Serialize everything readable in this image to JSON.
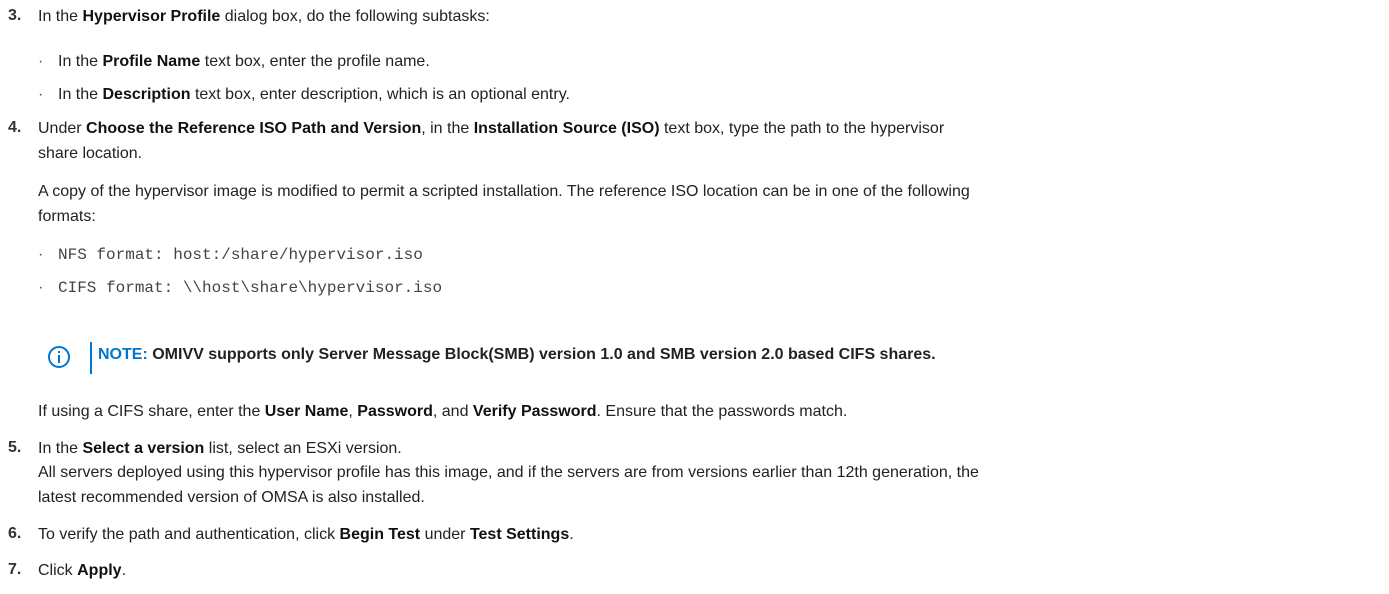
{
  "steps": [
    {
      "number": "3.",
      "intro": [
        "In the ",
        "Hypervisor Profile",
        " dialog box, do the following subtasks:"
      ],
      "bullets": [
        [
          "In the ",
          "Profile Name",
          " text box, enter the profile name."
        ],
        [
          "In the ",
          "Description",
          " text box, enter description, which is an optional entry."
        ]
      ]
    },
    {
      "number": "4.",
      "line1": [
        "Under ",
        "Choose the Reference ISO Path and Version",
        ", in the ",
        "Installation Source (ISO)",
        " text box, type the path to the hypervisor"
      ],
      "line2": "share location.",
      "para1": "A copy of the hypervisor image is modified to permit a scripted installation. The reference ISO location can be in one of the following",
      "para2": "formats:",
      "formats": [
        {
          "label": "NFS format: ",
          "value": "host:/share/hypervisor.iso"
        },
        {
          "label": "CIFS format: ",
          "value": "\\\\host\\share\\hypervisor.iso"
        }
      ],
      "note_label": "NOTE:",
      "note_text": " OMIVV supports only Server Message Block(SMB) version 1.0 and SMB version 2.0 based CIFS shares.",
      "cifs": [
        "If using a CIFS share, enter the ",
        "User Name",
        ", ",
        "Password",
        ", and ",
        "Verify Password",
        ". Ensure that the passwords match."
      ]
    },
    {
      "number": "5.",
      "line1": [
        "In the ",
        "Select a version",
        " list, select an ESXi version."
      ],
      "line2": "All servers deployed using this hypervisor profile has this image, and if the servers are from versions earlier than 12th generation, the",
      "line3": "latest recommended version of OMSA is also installed."
    },
    {
      "number": "6.",
      "line1": [
        "To verify the path and authentication, click ",
        "Begin Test",
        " under ",
        "Test Settings",
        "."
      ]
    },
    {
      "number": "7.",
      "line1": [
        "Click ",
        "Apply",
        "."
      ]
    }
  ]
}
